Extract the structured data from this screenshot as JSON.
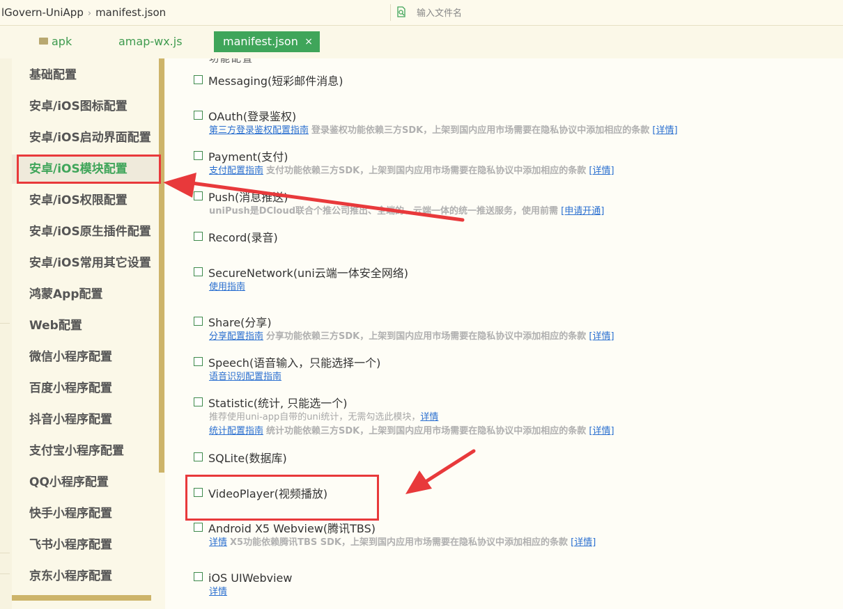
{
  "breadcrumb": {
    "project": "lGovern-UniApp",
    "file": "manifest.json"
  },
  "search": {
    "placeholder": "输入文件名"
  },
  "tabs": [
    {
      "label": "apk"
    },
    {
      "label": "amap-wx.js"
    },
    {
      "label": "manifest.json",
      "close": "×"
    }
  ],
  "sidebar": {
    "items": [
      "基础配置",
      "安卓/iOS图标配置",
      "安卓/iOS启动界面配置",
      "安卓/iOS模块配置",
      "安卓/iOS权限配置",
      "安卓/iOS原生插件配置",
      "安卓/iOS常用其它设置",
      "鸿蒙App配置",
      "Web配置",
      "微信小程序配置",
      "百度小程序配置",
      "抖音小程序配置",
      "支付宝小程序配置",
      "QQ小程序配置",
      "快手小程序配置",
      "飞书小程序配置",
      "京东小程序配置"
    ],
    "active_index": 3
  },
  "modules": {
    "partial_header": "功能配置",
    "messaging": {
      "title": "Messaging(短彩邮件消息)"
    },
    "oauth": {
      "title": "OAuth(登录鉴权)",
      "link": "第三方登录鉴权配置指南",
      "desc": "登录鉴权功能依赖三方SDK，上架到国内应用市场需要在隐私协议中添加相应的条款",
      "detail": "[详情]"
    },
    "payment": {
      "title": "Payment(支付)",
      "link": "支付配置指南",
      "desc": "支付功能依赖三方SDK，上架到国内应用市场需要在隐私协议中添加相应的条款",
      "detail": "[详情]"
    },
    "push": {
      "title": "Push(消息推送)",
      "desc": "uniPush是DCloud联合个推公司推出、全端的、云端一体的统一推送服务，使用前需",
      "detail": "[申请开通]"
    },
    "record": {
      "title": "Record(录音)"
    },
    "securenetwork": {
      "title": "SecureNetwork(uni云端一体安全网络)",
      "link": "使用指南"
    },
    "share": {
      "title": "Share(分享)",
      "link": "分享配置指南",
      "desc": "分享功能依赖三方SDK，上架到国内应用市场需要在隐私协议中添加相应的条款",
      "detail": "[详情]"
    },
    "speech": {
      "title": "Speech(语音输入，只能选择一个)",
      "link": "语音识别配置指南"
    },
    "statistic": {
      "title": "Statistic(统计, 只能选一个)",
      "hint": "推荐使用uni-app自带的uni统计，无需勾选此模块，",
      "hint_link": "详情",
      "link": "统计配置指南",
      "desc": "统计功能依赖三方SDK，上架到国内应用市场需要在隐私协议中添加相应的条款",
      "detail": "[详情]"
    },
    "sqlite": {
      "title": "SQLite(数据库)"
    },
    "videoplayer": {
      "title": "VideoPlayer(视频播放)"
    },
    "x5": {
      "title": "Android X5 Webview(腾讯TBS)",
      "link": "详情",
      "desc": "X5功能依赖腾讯TBS SDK，上架到国内应用市场需要在隐私协议中添加相应的条款",
      "detail": "[详情]"
    },
    "uiwebview": {
      "title": "iOS UIWebview",
      "link": "详情"
    }
  },
  "colors": {
    "accent": "#3fa55a",
    "annotation": "#e8393b",
    "link": "#2a6fd0",
    "scrollbar": "#cdb46a"
  }
}
